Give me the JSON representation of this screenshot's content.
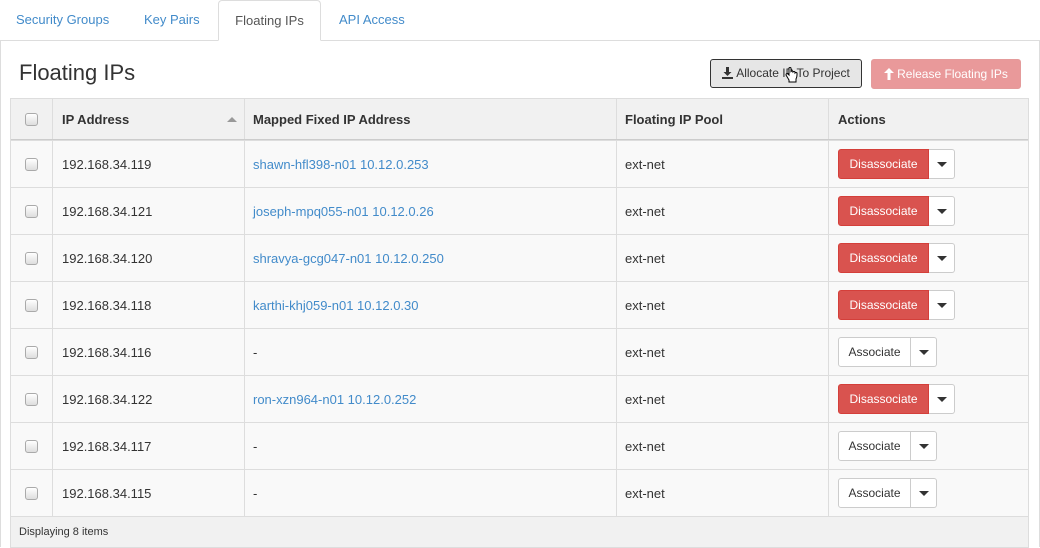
{
  "tabs": [
    {
      "label": "Security Groups",
      "active": false
    },
    {
      "label": "Key Pairs",
      "active": false
    },
    {
      "label": "Floating IPs",
      "active": true
    },
    {
      "label": "API Access",
      "active": false
    }
  ],
  "page_title": "Floating IPs",
  "toolbar": {
    "allocate_label": "Allocate IP To Project",
    "release_label": "Release Floating IPs"
  },
  "table": {
    "headers": {
      "ip": "IP Address",
      "mapped": "Mapped Fixed IP Address",
      "pool": "Floating IP Pool",
      "actions": "Actions"
    },
    "rows": [
      {
        "ip": "192.168.34.119",
        "mapped": "shawn-hfl398-n01 10.12.0.253",
        "pool": "ext-net",
        "action": "Disassociate"
      },
      {
        "ip": "192.168.34.121",
        "mapped": "joseph-mpq055-n01 10.12.0.26",
        "pool": "ext-net",
        "action": "Disassociate"
      },
      {
        "ip": "192.168.34.120",
        "mapped": "shravya-gcg047-n01 10.12.0.250",
        "pool": "ext-net",
        "action": "Disassociate"
      },
      {
        "ip": "192.168.34.118",
        "mapped": "karthi-khj059-n01 10.12.0.30",
        "pool": "ext-net",
        "action": "Disassociate"
      },
      {
        "ip": "192.168.34.116",
        "mapped": "-",
        "pool": "ext-net",
        "action": "Associate"
      },
      {
        "ip": "192.168.34.122",
        "mapped": "ron-xzn964-n01 10.12.0.252",
        "pool": "ext-net",
        "action": "Disassociate"
      },
      {
        "ip": "192.168.34.117",
        "mapped": "-",
        "pool": "ext-net",
        "action": "Associate"
      },
      {
        "ip": "192.168.34.115",
        "mapped": "-",
        "pool": "ext-net",
        "action": "Associate"
      }
    ],
    "footer": "Displaying 8 items"
  },
  "colors": {
    "link": "#428bca",
    "danger": "#d9534f",
    "release_disabled": "#e9999a"
  }
}
